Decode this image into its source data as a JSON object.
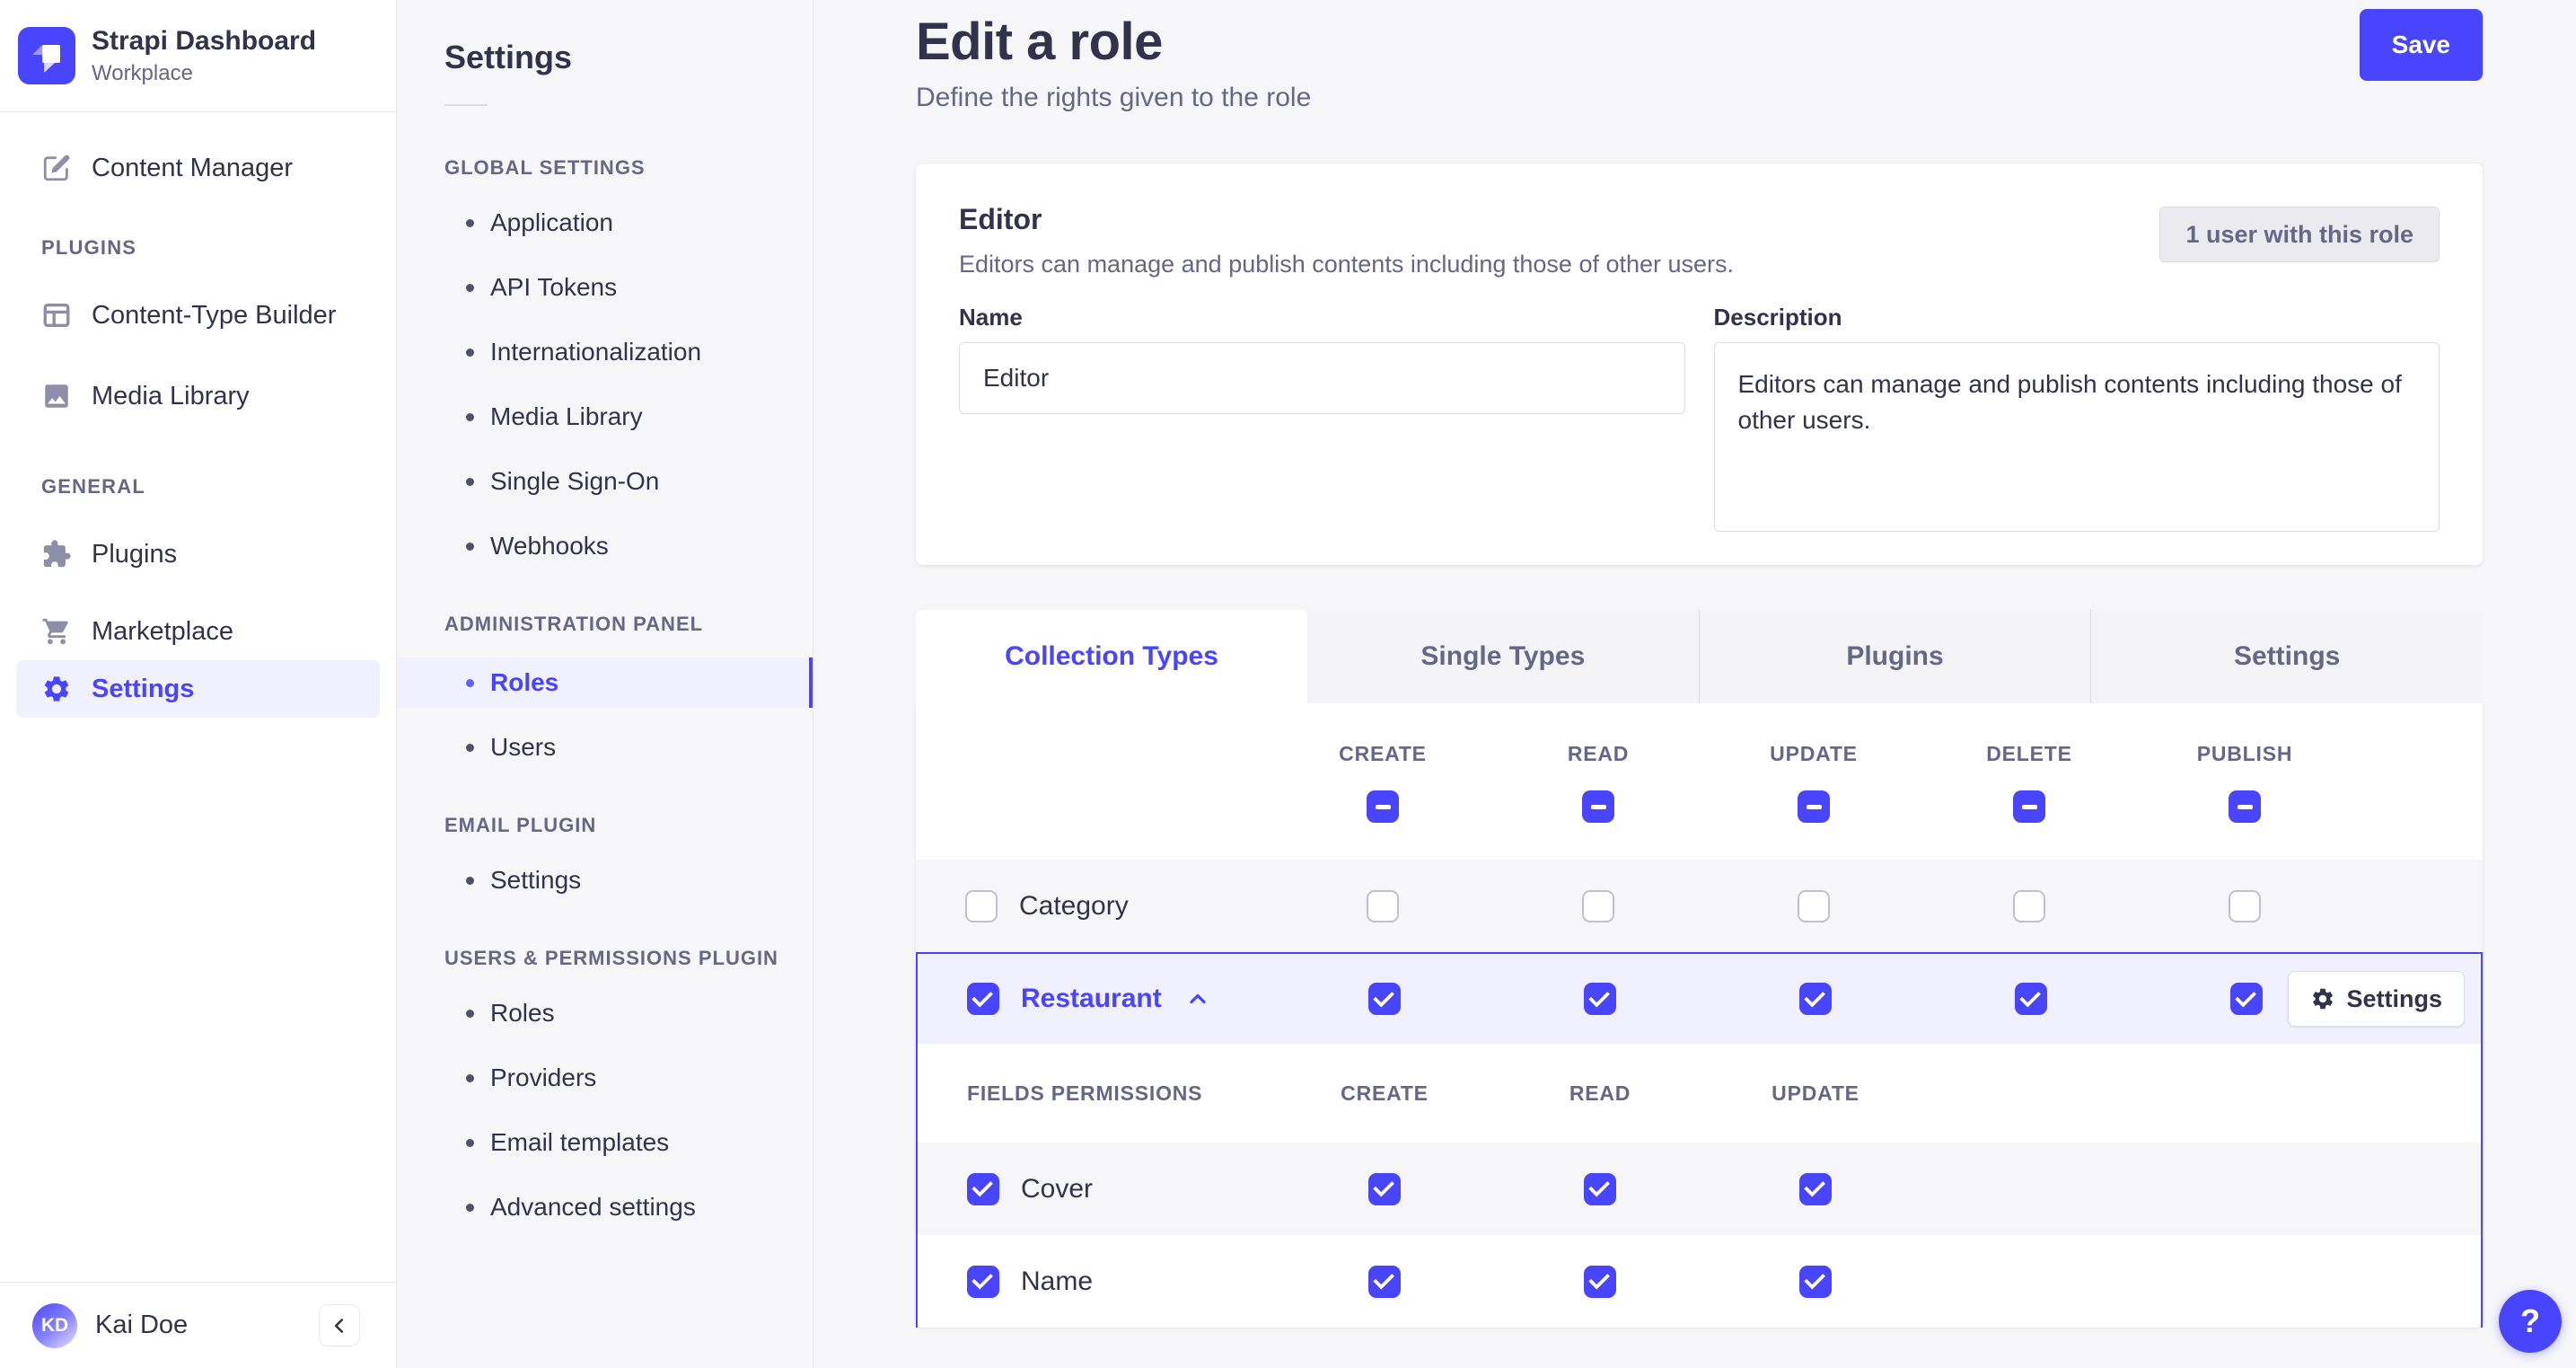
{
  "brand": {
    "title": "Strapi Dashboard",
    "subtitle": "Workplace"
  },
  "sidebar": {
    "content_manager": "Content Manager",
    "plugins_heading": "PLUGINS",
    "content_type_builder": "Content-Type Builder",
    "media_library": "Media Library",
    "general_heading": "GENERAL",
    "plugins": "Plugins",
    "marketplace": "Marketplace",
    "settings": "Settings",
    "user_initials": "KD",
    "user_name": "Kai Doe"
  },
  "settings_nav": {
    "title": "Settings",
    "sections": [
      {
        "heading": "GLOBAL SETTINGS",
        "items": [
          "Application",
          "API Tokens",
          "Internationalization",
          "Media Library",
          "Single Sign-On",
          "Webhooks"
        ]
      },
      {
        "heading": "ADMINISTRATION PANEL",
        "items": [
          "Roles",
          "Users"
        ]
      },
      {
        "heading": "EMAIL PLUGIN",
        "items": [
          "Settings"
        ]
      },
      {
        "heading": "USERS & PERMISSIONS PLUGIN",
        "items": [
          "Roles",
          "Providers",
          "Email templates",
          "Advanced settings"
        ]
      }
    ],
    "active_item": "Roles"
  },
  "header": {
    "title": "Edit a role",
    "subtitle": "Define the rights given to the role",
    "save_label": "Save"
  },
  "role_card": {
    "title": "Editor",
    "subtitle": "Editors can manage and publish contents including those of other users.",
    "users_count_label": "1 user with this role",
    "name_label": "Name",
    "name_value": "Editor",
    "description_label": "Description",
    "description_value": "Editors can manage and publish contents including those of other users."
  },
  "permissions": {
    "tabs": [
      "Collection Types",
      "Single Types",
      "Plugins",
      "Settings"
    ],
    "active_tab": "Collection Types",
    "columns": [
      "CREATE",
      "READ",
      "UPDATE",
      "DELETE",
      "PUBLISH"
    ],
    "header_states": [
      "mixed",
      "mixed",
      "mixed",
      "mixed",
      "mixed"
    ],
    "rows": [
      {
        "label": "Category",
        "checked": false,
        "cells": [
          false,
          false,
          false,
          false,
          false
        ]
      },
      {
        "label": "Restaurant",
        "checked": true,
        "expanded": true,
        "settings_label": "Settings",
        "cells": [
          true,
          true,
          true,
          true,
          true
        ]
      }
    ],
    "fields_section": {
      "heading": "FIELDS PERMISSIONS",
      "columns": [
        "CREATE",
        "READ",
        "UPDATE"
      ],
      "rows": [
        {
          "label": "Cover",
          "checked": true,
          "cells": [
            true,
            true,
            true
          ]
        },
        {
          "label": "Name",
          "checked": true,
          "cells": [
            true,
            true,
            true
          ]
        }
      ]
    }
  },
  "help": {
    "label": "?"
  },
  "colors": {
    "accent": "#4945ff",
    "accent_light": "#f0f0ff",
    "page_bg": "#f6f6f9",
    "text": "#32324d",
    "muted": "#666687",
    "border": "#eaeaef"
  }
}
